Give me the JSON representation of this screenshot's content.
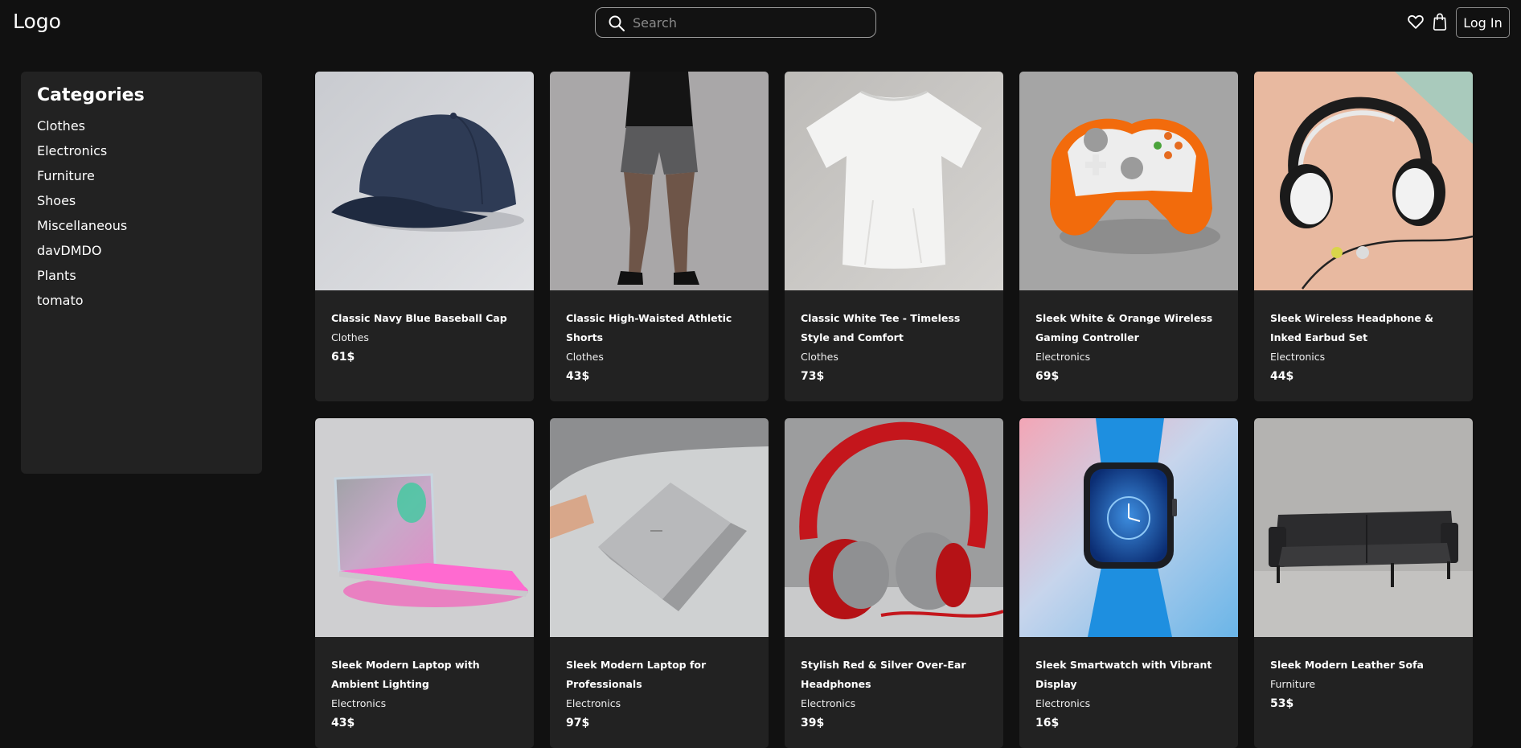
{
  "header": {
    "logo": "Logo",
    "search_placeholder": "Search",
    "login_label": "Log In",
    "icons": [
      "search-icon",
      "heart-icon",
      "shopping-bag-icon"
    ]
  },
  "sidebar": {
    "title": "Categories",
    "items": [
      "Clothes",
      "Electronics",
      "Furniture",
      "Shoes",
      "Miscellaneous",
      "davDMDO",
      "Plants",
      "tomato"
    ]
  },
  "products": [
    {
      "title": "Classic Navy Blue Baseball Cap",
      "category": "Clothes",
      "price": "61$"
    },
    {
      "title": "Classic High-Waisted Athletic Shorts",
      "category": "Clothes",
      "price": "43$"
    },
    {
      "title": "Classic White Tee - Timeless Style and Comfort",
      "category": "Clothes",
      "price": "73$"
    },
    {
      "title": "Sleek White & Orange Wireless Gaming Controller",
      "category": "Electronics",
      "price": "69$"
    },
    {
      "title": "Sleek Wireless Headphone & Inked Earbud Set",
      "category": "Electronics",
      "price": "44$"
    },
    {
      "title": "Sleek Modern Laptop with Ambient Lighting",
      "category": "Electronics",
      "price": "43$"
    },
    {
      "title": "Sleek Modern Laptop for Professionals",
      "category": "Electronics",
      "price": "97$"
    },
    {
      "title": "Stylish Red & Silver Over-Ear Headphones",
      "category": "Electronics",
      "price": "39$"
    },
    {
      "title": "Sleek Smartwatch with Vibrant Display",
      "category": "Electronics",
      "price": "16$"
    },
    {
      "title": "Sleek Modern Leather Sofa",
      "category": "Furniture",
      "price": "53$"
    }
  ]
}
